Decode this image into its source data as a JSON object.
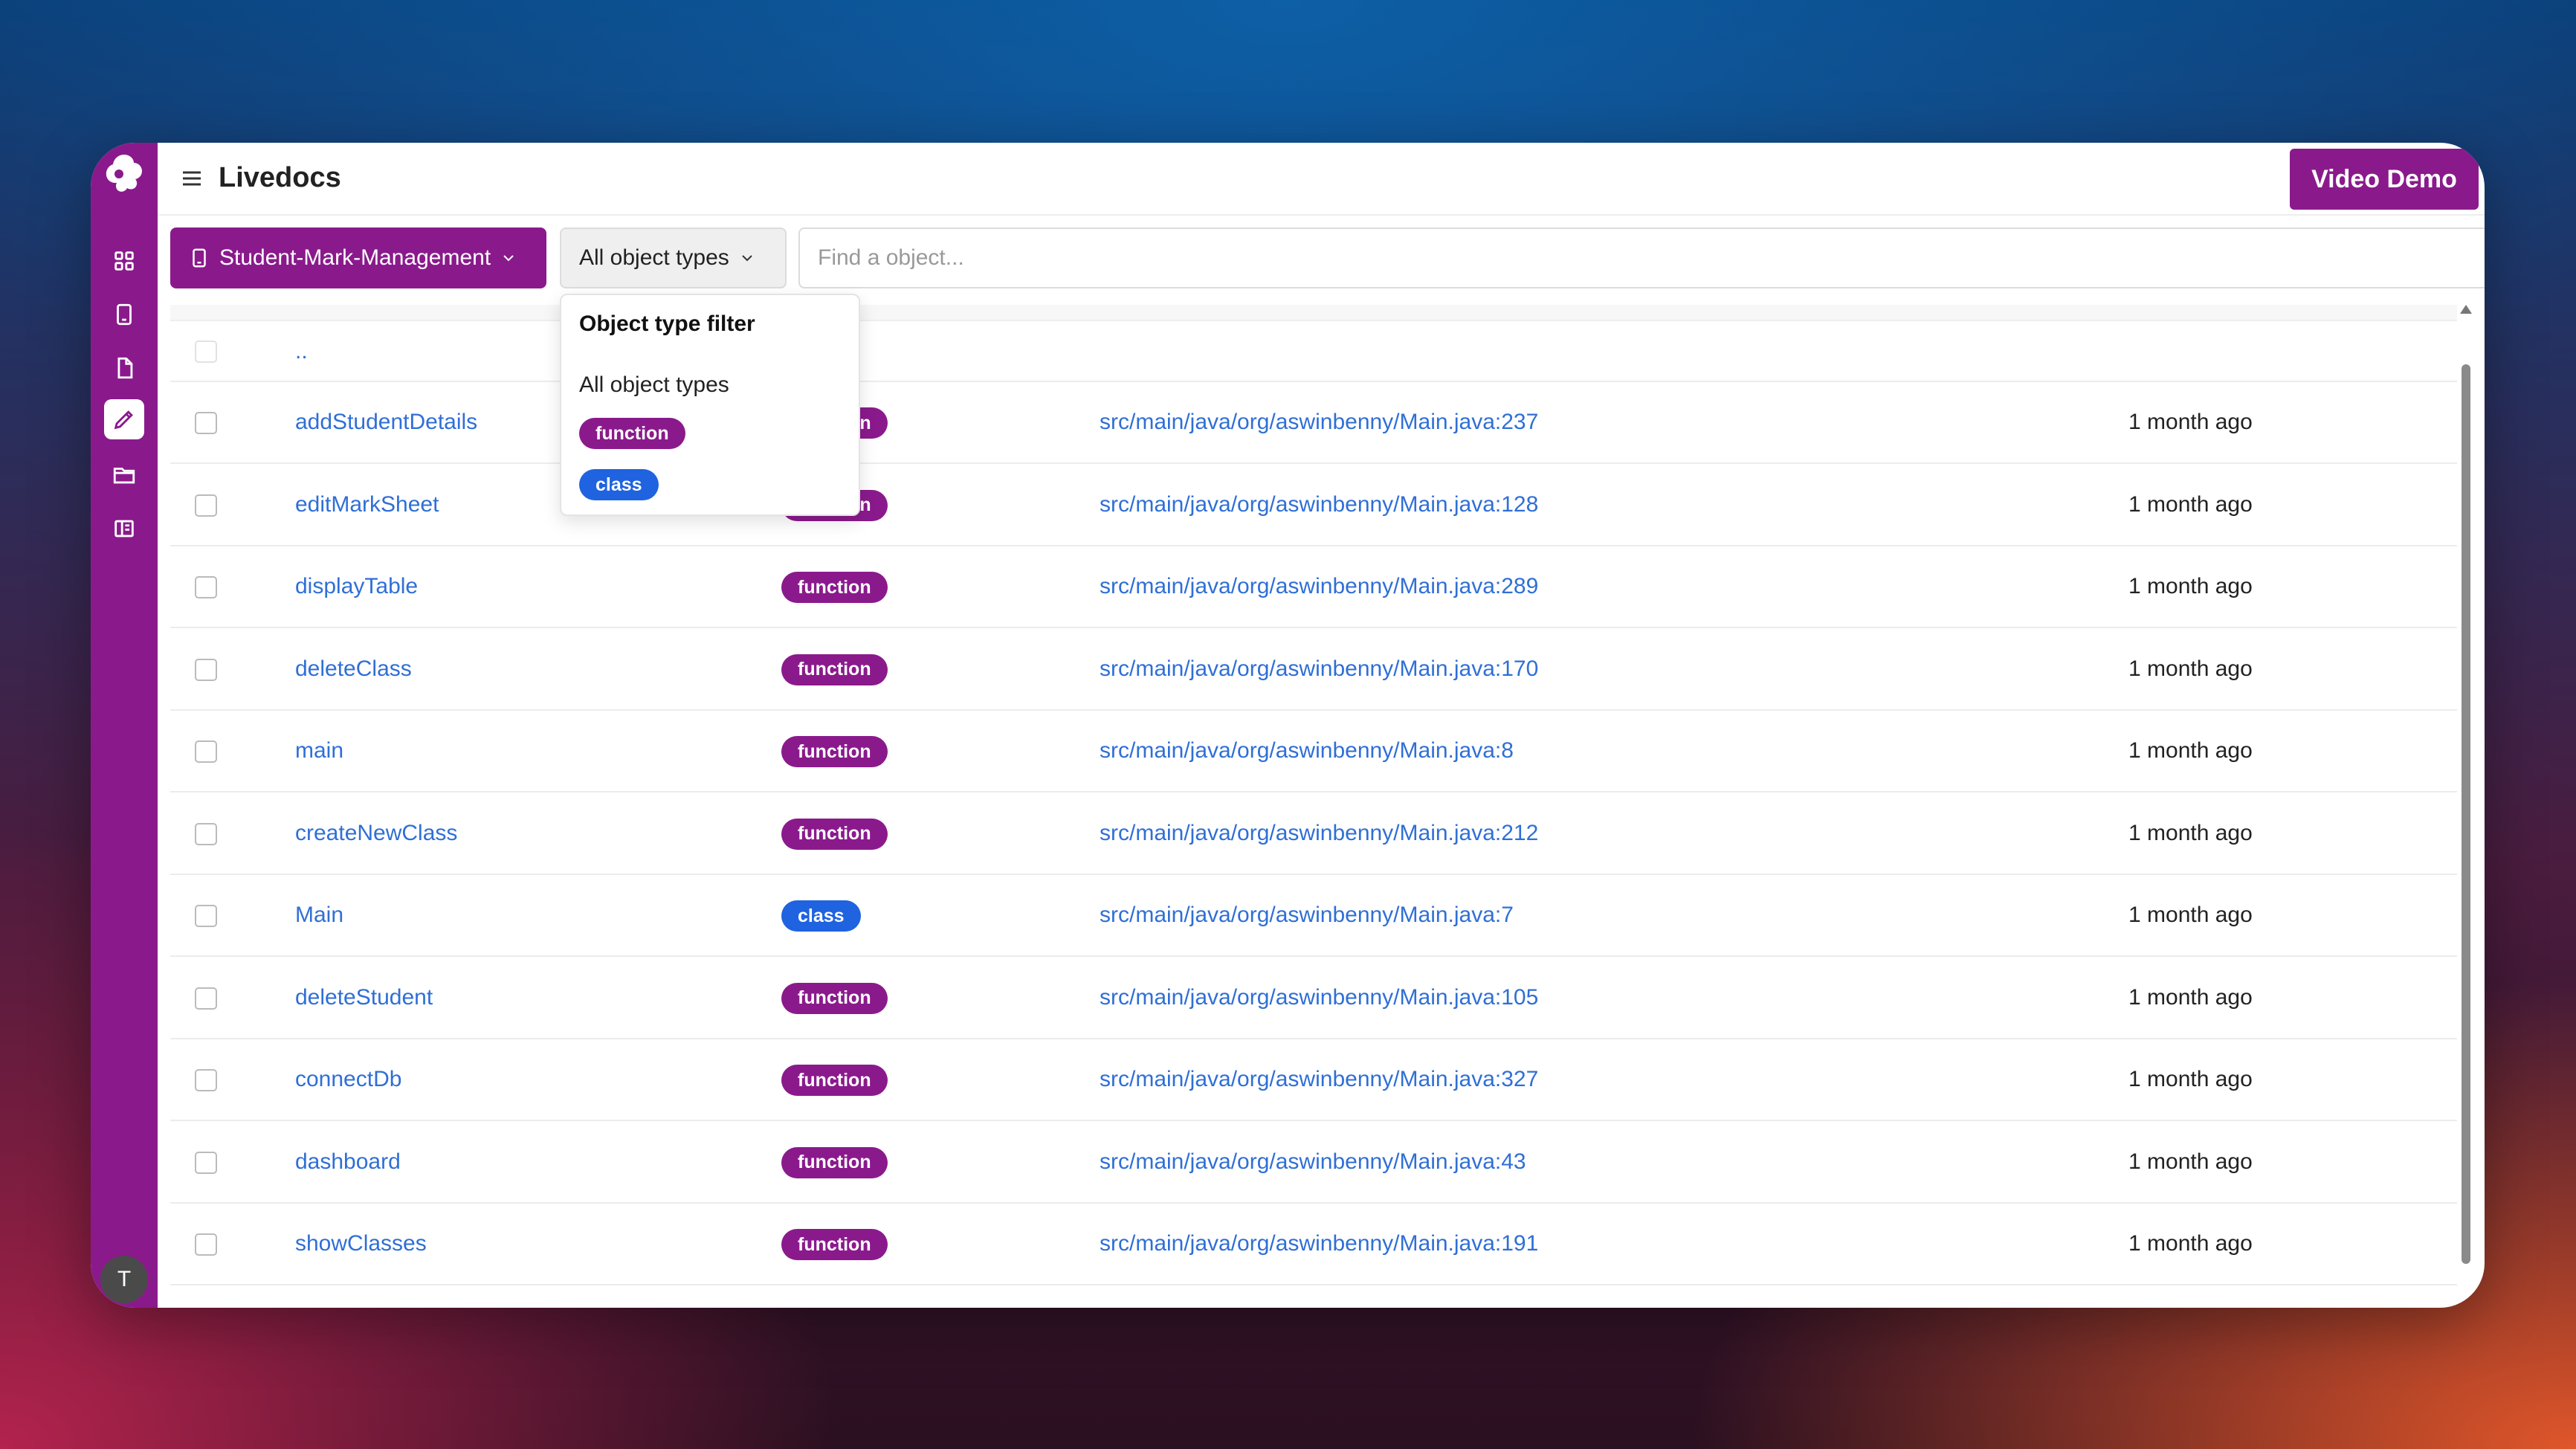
{
  "app": {
    "title": "Livedocs"
  },
  "header": {
    "video_demo_label": "Video Demo"
  },
  "toolbar": {
    "project_label": "Student-Mark-Management",
    "type_filter_label": "All object types",
    "search_placeholder": "Find a object..."
  },
  "dropdown": {
    "title": "Object type filter",
    "all_label": "All object types",
    "options": [
      "function",
      "class"
    ]
  },
  "sidebar": {
    "icons": [
      "grid-icon",
      "tablet-icon",
      "file-icon",
      "pencil-icon",
      "folder-icon",
      "book-icon"
    ],
    "active": "pencil-icon",
    "avatar_initial": "T"
  },
  "table": {
    "parent_row_label": "..",
    "rows": [
      {
        "name": "addStudentDetails",
        "type": "function",
        "path": "src/main/java/org/aswinbenny/Main.java:237",
        "updated": "1 month ago"
      },
      {
        "name": "editMarkSheet",
        "type": "function",
        "path": "src/main/java/org/aswinbenny/Main.java:128",
        "updated": "1 month ago"
      },
      {
        "name": "displayTable",
        "type": "function",
        "path": "src/main/java/org/aswinbenny/Main.java:289",
        "updated": "1 month ago"
      },
      {
        "name": "deleteClass",
        "type": "function",
        "path": "src/main/java/org/aswinbenny/Main.java:170",
        "updated": "1 month ago"
      },
      {
        "name": "main",
        "type": "function",
        "path": "src/main/java/org/aswinbenny/Main.java:8",
        "updated": "1 month ago"
      },
      {
        "name": "createNewClass",
        "type": "function",
        "path": "src/main/java/org/aswinbenny/Main.java:212",
        "updated": "1 month ago"
      },
      {
        "name": "Main",
        "type": "class",
        "path": "src/main/java/org/aswinbenny/Main.java:7",
        "updated": "1 month ago"
      },
      {
        "name": "deleteStudent",
        "type": "function",
        "path": "src/main/java/org/aswinbenny/Main.java:105",
        "updated": "1 month ago"
      },
      {
        "name": "connectDb",
        "type": "function",
        "path": "src/main/java/org/aswinbenny/Main.java:327",
        "updated": "1 month ago"
      },
      {
        "name": "dashboard",
        "type": "function",
        "path": "src/main/java/org/aswinbenny/Main.java:43",
        "updated": "1 month ago"
      },
      {
        "name": "showClasses",
        "type": "function",
        "path": "src/main/java/org/aswinbenny/Main.java:191",
        "updated": "1 month ago"
      }
    ]
  },
  "colors": {
    "brand": "#8a1a8c",
    "class_badge": "#1f63e0",
    "link": "#2f6fd6"
  }
}
